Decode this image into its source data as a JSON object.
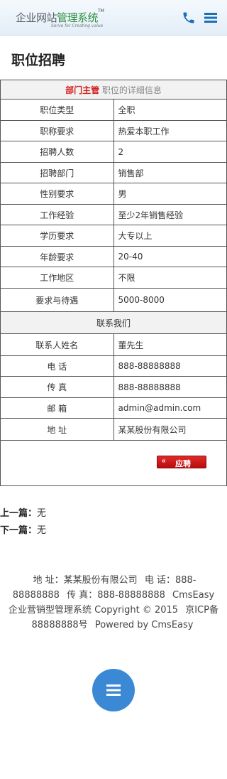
{
  "header": {
    "logo_text_a": "企业网站",
    "logo_text_b": "管理系统",
    "logo_tm": "TM",
    "logo_sub": "Serve for Creating value",
    "phone_icon": "phone-icon",
    "menu_icon": "hamburger-menu-icon",
    "accent_color": "#1a6fb5"
  },
  "page": {
    "title": "职位招聘"
  },
  "job": {
    "position_name": "部门主管",
    "position_desc": "职位的详细信息",
    "fields": [
      {
        "label": "职位类型",
        "value": "全职"
      },
      {
        "label": "职称要求",
        "value": "热爱本职工作"
      },
      {
        "label": "招聘人数",
        "value": "2"
      },
      {
        "label": "招聘部门",
        "value": "销售部"
      },
      {
        "label": "性别要求",
        "value": "男"
      },
      {
        "label": "工作经验",
        "value": "至少2年销售经验"
      },
      {
        "label": "学历要求",
        "value": "大专以上"
      },
      {
        "label": "年龄要求",
        "value": "20-40"
      },
      {
        "label": "工作地区",
        "value": "不限"
      },
      {
        "label": "要求与待遇",
        "value": "5000-8000"
      }
    ],
    "contact_title": "联系我们",
    "contact": [
      {
        "label": "联系人姓名",
        "value": "董先生"
      },
      {
        "label": "电 话",
        "value": "888-88888888"
      },
      {
        "label": "传 真",
        "value": "888-88888888"
      },
      {
        "label": "邮 箱",
        "value": "admin@admin.com"
      },
      {
        "label": "地 址",
        "value": "某某股份有限公司"
      }
    ],
    "apply_icon": "double-chevron-left-icon",
    "apply_label": "应聘"
  },
  "nav": {
    "prev_label": "上一篇：",
    "prev_value": "无",
    "next_label": "下一篇：",
    "next_value": "无"
  },
  "footer": {
    "address": "地 址：某某股份有限公司",
    "phone": "电 话：888-88888888",
    "fax": "传 真：888-88888888",
    "copyright": "CmsEasy 企业营销型管理系统 Copyright © 2015",
    "icp": "京ICP备88888888号",
    "powered": "Powered by CmsEasy"
  },
  "fab": {
    "icon": "menu-icon",
    "color": "#3b88d4"
  }
}
